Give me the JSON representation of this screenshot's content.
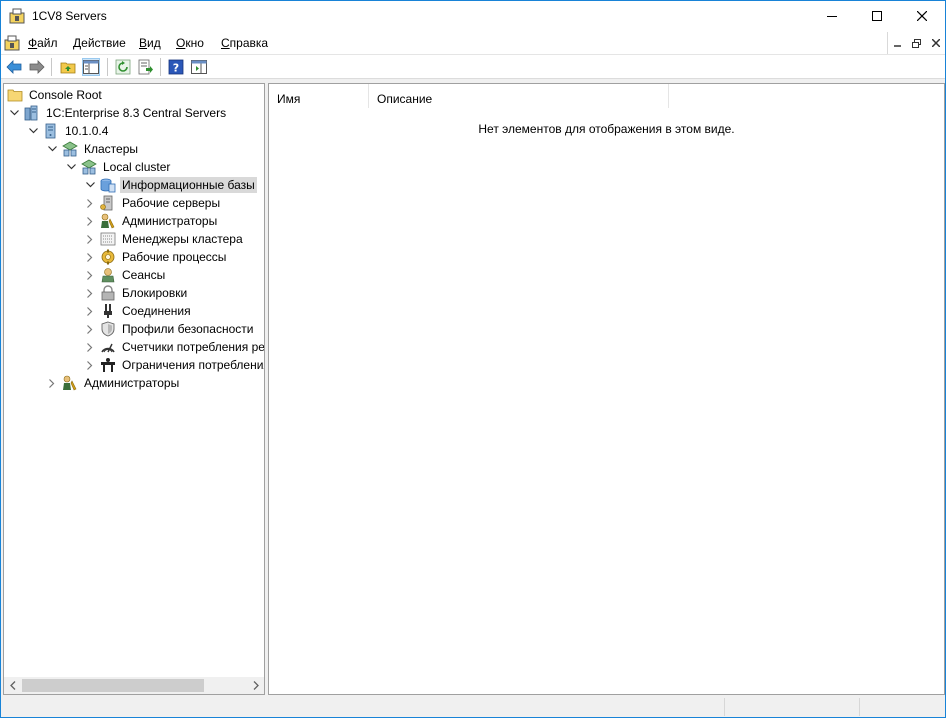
{
  "window": {
    "title": "1CV8 Servers"
  },
  "menu": {
    "items": [
      {
        "label": "Файл",
        "mnemonic": "Ф",
        "rest": "айл"
      },
      {
        "label": "Действие",
        "mnemonic": "Д",
        "rest": "ействие"
      },
      {
        "label": "Вид",
        "mnemonic": "В",
        "rest": "ид"
      },
      {
        "label": "Окно",
        "mnemonic": "О",
        "rest": "кно"
      },
      {
        "label": "Справка",
        "mnemonic": "С",
        "rest": "правка"
      }
    ]
  },
  "toolbar": {
    "buttons": [
      "back-icon",
      "forward-icon",
      "up-folder-icon",
      "show-hide-tree-icon",
      "refresh-icon",
      "export-list-icon",
      "help-icon",
      "action-pane-icon"
    ]
  },
  "tree": {
    "console_root": "Console Root",
    "servers": "1C:Enterprise 8.3 Central Servers",
    "server": "10.1.0.4",
    "clusters": "Кластеры",
    "local_cluster": "Local cluster",
    "cluster_items": [
      "Информационные базы",
      "Рабочие серверы",
      "Администраторы",
      "Менеджеры кластера",
      "Рабочие процессы",
      "Сеансы",
      "Блокировки",
      "Соединения",
      "Профили безопасности",
      "Счетчики потребления ресурсов",
      "Ограничения потребления ресурсов"
    ],
    "server_admins": "Администраторы"
  },
  "list": {
    "columns": [
      "Имя",
      "Описание"
    ],
    "empty_message": "Нет элементов для отображения в этом виде."
  },
  "colors": {
    "window_border": "#1883d7",
    "selection": "#d9d9d9"
  }
}
